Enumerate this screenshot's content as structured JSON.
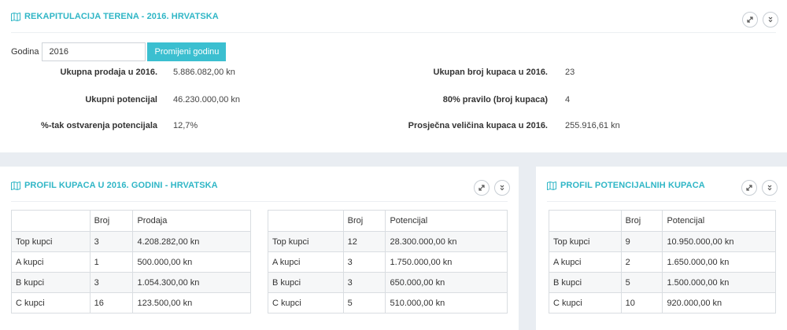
{
  "summary": {
    "title": "REKAPITULACIJA TERENA - 2016. HRVATSKA",
    "year_label": "Godina",
    "year_value": "2016",
    "change_button": "Promijeni godinu",
    "stats_left": [
      {
        "label": "Ukupna prodaja u 2016.",
        "value": "5.886.082,00 kn"
      },
      {
        "label": "Ukupni potencijal",
        "value": "46.230.000,00 kn"
      },
      {
        "label": "%-tak ostvarenja potencijala",
        "value": "12,7%"
      }
    ],
    "stats_right": [
      {
        "label": "Ukupan broj kupaca u 2016.",
        "value": "23"
      },
      {
        "label": "80% pravilo (broj kupaca)",
        "value": "4"
      },
      {
        "label": "Prosječna veličina kupaca u 2016.",
        "value": "255.916,61 kn"
      }
    ]
  },
  "profile": {
    "title": "PROFIL KUPACA U 2016. GODINI - HRVATSKA",
    "sales_table": {
      "headers": [
        "",
        "Broj",
        "Prodaja"
      ],
      "rows": [
        [
          "Top kupci",
          "3",
          "4.208.282,00 kn"
        ],
        [
          "A kupci",
          "1",
          "500.000,00 kn"
        ],
        [
          "B kupci",
          "3",
          "1.054.300,00 kn"
        ],
        [
          "C kupci",
          "16",
          "123.500,00 kn"
        ]
      ]
    },
    "potential_table": {
      "headers": [
        "",
        "Broj",
        "Potencijal"
      ],
      "rows": [
        [
          "Top kupci",
          "12",
          "28.300.000,00 kn"
        ],
        [
          "A kupci",
          "3",
          "1.750.000,00 kn"
        ],
        [
          "B kupci",
          "3",
          "650.000,00 kn"
        ],
        [
          "C kupci",
          "5",
          "510.000,00 kn"
        ]
      ]
    }
  },
  "potential_profile": {
    "title": "PROFIL POTENCIJALNIH KUPACA",
    "table": {
      "headers": [
        "",
        "Broj",
        "Potencijal"
      ],
      "rows": [
        [
          "Top kupci",
          "9",
          "10.950.000,00 kn"
        ],
        [
          "A kupci",
          "2",
          "1.650.000,00 kn"
        ],
        [
          "B kupci",
          "5",
          "1.500.000,00 kn"
        ],
        [
          "C kupci",
          "10",
          "920.000,00 kn"
        ]
      ]
    }
  },
  "colors": {
    "accent": "#2fb6c6",
    "button": "#3bbfd0",
    "background": "#e9edf2"
  },
  "icons": {
    "panel_icon": "map-icon",
    "expand": "expand-icon",
    "collapse": "chevron-double-down-icon"
  }
}
